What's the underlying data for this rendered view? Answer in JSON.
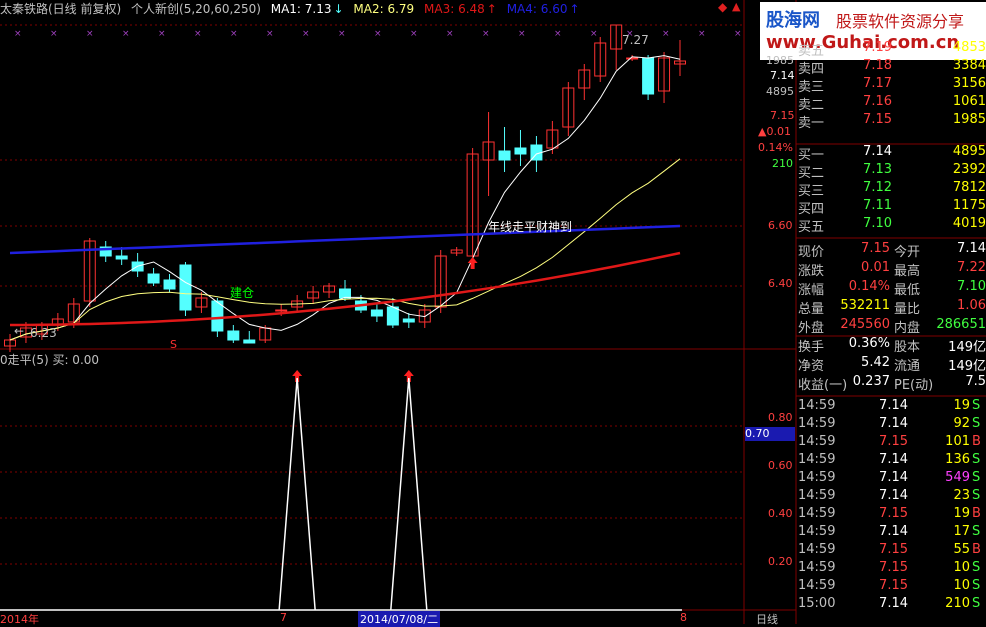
{
  "header": {
    "title": "太秦铁路(日线 前复权)",
    "indicator": "个人新创(5,20,60,250)",
    "ma1": "MA1: 7.13",
    "ma2": "MA2: 6.79",
    "ma3": "MA3: 6.48",
    "ma4": "MA4: 6.60",
    "ma1_arrow": "↓",
    "ma3_arrow": "↑",
    "ma4_arrow": "↑"
  },
  "logo": {
    "name": "股海网",
    "slogan": "股票软件资源分享",
    "url": "www.Guhai.com.cn"
  },
  "chart_annotations": {
    "high_label": "7.27",
    "low_label": "6.23",
    "signal_text": "年线走平财神到",
    "build_text": "建仓",
    "s_marker": "S"
  },
  "indicator_header": "0走平(5)  买: 0.00",
  "indicator_current": "0.70",
  "date_labels": [
    "2014年",
    "7",
    "2014/07/08/二",
    "8"
  ],
  "period_label": "日线",
  "side_prices": [
    "1985",
    "7.14",
    "4895",
    "7.15",
    "▲0.01",
    "0.14%",
    "210",
    "6.60",
    "6.40"
  ],
  "order_book": {
    "asks": [
      {
        "label": "卖五",
        "price": "7.19",
        "vol": "4853"
      },
      {
        "label": "卖四",
        "price": "7.18",
        "vol": "3384"
      },
      {
        "label": "卖三",
        "price": "7.17",
        "vol": "3156"
      },
      {
        "label": "卖二",
        "price": "7.16",
        "vol": "1061"
      },
      {
        "label": "卖一",
        "price": "7.15",
        "vol": "1985"
      }
    ],
    "bids": [
      {
        "label": "买一",
        "price": "7.14",
        "vol": "4895"
      },
      {
        "label": "买二",
        "price": "7.13",
        "vol": "2392"
      },
      {
        "label": "买三",
        "price": "7.12",
        "vol": "7812"
      },
      {
        "label": "买四",
        "price": "7.11",
        "vol": "1175"
      },
      {
        "label": "买五",
        "price": "7.10",
        "vol": "4019"
      }
    ]
  },
  "quote": [
    {
      "l1": "现价",
      "v1": "7.15",
      "l2": "今开",
      "v2": "7.14"
    },
    {
      "l1": "涨跌",
      "v1": "0.01",
      "l2": "最高",
      "v2": "7.22"
    },
    {
      "l1": "涨幅",
      "v1": "0.14%",
      "l2": "最低",
      "v2": "7.10"
    },
    {
      "l1": "总量",
      "v1": "532211",
      "l2": "量比",
      "v2": "1.06"
    },
    {
      "l1": "外盘",
      "v1": "245560",
      "l2": "内盘",
      "v2": "286651"
    },
    {
      "l1": "换手",
      "v1": "0.36%",
      "l2": "股本",
      "v2": "149亿"
    },
    {
      "l1": "净资",
      "v1": "5.42",
      "l2": "流通",
      "v2": "149亿"
    },
    {
      "l1": "收益(一)",
      "v1": "0.237",
      "l2": "PE(动)",
      "v2": "7.5"
    }
  ],
  "ticks": [
    {
      "time": "14:59",
      "price": "7.14",
      "vol": "19",
      "side": "S"
    },
    {
      "time": "14:59",
      "price": "7.14",
      "vol": "92",
      "side": "S"
    },
    {
      "time": "14:59",
      "price": "7.15",
      "vol": "101",
      "side": "B"
    },
    {
      "time": "14:59",
      "price": "7.14",
      "vol": "136",
      "side": "S"
    },
    {
      "time": "14:59",
      "price": "7.14",
      "vol": "549",
      "side": "S"
    },
    {
      "time": "14:59",
      "price": "7.14",
      "vol": "23",
      "side": "S"
    },
    {
      "time": "14:59",
      "price": "7.15",
      "vol": "19",
      "side": "B"
    },
    {
      "time": "14:59",
      "price": "7.14",
      "vol": "17",
      "side": "S"
    },
    {
      "time": "14:59",
      "price": "7.15",
      "vol": "55",
      "side": "B"
    },
    {
      "time": "14:59",
      "price": "7.15",
      "vol": "10",
      "side": "S"
    },
    {
      "time": "14:59",
      "price": "7.15",
      "vol": "10",
      "side": "S"
    },
    {
      "time": "15:00",
      "price": "7.14",
      "vol": "210",
      "side": "S"
    }
  ],
  "colors": {
    "up": "#ff3232",
    "down": "#54ffff",
    "ma1": "#ffffff",
    "ma2": "#ffff80",
    "ma3": "#e01818",
    "ma4": "#2020e0",
    "grid": "#800000",
    "panel_up": "#ff4040",
    "panel_down": "#40ff40",
    "text": "#c0c0c0",
    "yellow": "#ffff00"
  },
  "chart_data": {
    "type": "candlestick",
    "candles": [
      {
        "o": 6.2,
        "h": 6.24,
        "l": 6.18,
        "c": 6.22
      },
      {
        "o": 6.23,
        "h": 6.28,
        "l": 6.21,
        "c": 6.26
      },
      {
        "o": 6.24,
        "h": 6.28,
        "l": 6.22,
        "c": 6.27
      },
      {
        "o": 6.27,
        "h": 6.31,
        "l": 6.25,
        "c": 6.29
      },
      {
        "o": 6.28,
        "h": 6.36,
        "l": 6.26,
        "c": 6.34
      },
      {
        "o": 6.35,
        "h": 6.56,
        "l": 6.33,
        "c": 6.55
      },
      {
        "o": 6.53,
        "h": 6.55,
        "l": 6.48,
        "c": 6.5
      },
      {
        "o": 6.5,
        "h": 6.53,
        "l": 6.47,
        "c": 6.49
      },
      {
        "o": 6.48,
        "h": 6.51,
        "l": 6.43,
        "c": 6.45
      },
      {
        "o": 6.44,
        "h": 6.46,
        "l": 6.4,
        "c": 6.41
      },
      {
        "o": 6.42,
        "h": 6.44,
        "l": 6.38,
        "c": 6.39
      },
      {
        "o": 6.47,
        "h": 6.48,
        "l": 6.3,
        "c": 6.32
      },
      {
        "o": 6.33,
        "h": 6.38,
        "l": 6.31,
        "c": 6.36
      },
      {
        "o": 6.35,
        "h": 6.36,
        "l": 6.23,
        "c": 6.25
      },
      {
        "o": 6.25,
        "h": 6.27,
        "l": 6.21,
        "c": 6.22
      },
      {
        "o": 6.22,
        "h": 6.25,
        "l": 6.21,
        "c": 6.21
      },
      {
        "o": 6.22,
        "h": 6.27,
        "l": 6.21,
        "c": 6.26
      },
      {
        "o": 6.32,
        "h": 6.34,
        "l": 6.3,
        "c": 6.32
      },
      {
        "o": 6.33,
        "h": 6.37,
        "l": 6.31,
        "c": 6.35
      },
      {
        "o": 6.36,
        "h": 6.4,
        "l": 6.34,
        "c": 6.38
      },
      {
        "o": 6.38,
        "h": 6.41,
        "l": 6.36,
        "c": 6.4
      },
      {
        "o": 6.39,
        "h": 6.42,
        "l": 6.35,
        "c": 6.36
      },
      {
        "o": 6.35,
        "h": 6.37,
        "l": 6.31,
        "c": 6.32
      },
      {
        "o": 6.32,
        "h": 6.34,
        "l": 6.28,
        "c": 6.3
      },
      {
        "o": 6.33,
        "h": 6.36,
        "l": 6.26,
        "c": 6.27
      },
      {
        "o": 6.29,
        "h": 6.31,
        "l": 6.26,
        "c": 6.28
      },
      {
        "o": 6.28,
        "h": 6.34,
        "l": 6.26,
        "c": 6.32
      },
      {
        "o": 6.33,
        "h": 6.52,
        "l": 6.31,
        "c": 6.5
      },
      {
        "o": 6.51,
        "h": 6.53,
        "l": 6.5,
        "c": 6.52
      },
      {
        "o": 6.5,
        "h": 6.86,
        "l": 6.47,
        "c": 6.84
      },
      {
        "o": 6.82,
        "h": 6.98,
        "l": 6.7,
        "c": 6.88
      },
      {
        "o": 6.85,
        "h": 6.93,
        "l": 6.78,
        "c": 6.82
      },
      {
        "o": 6.86,
        "h": 6.92,
        "l": 6.8,
        "c": 6.84
      },
      {
        "o": 6.87,
        "h": 6.9,
        "l": 6.78,
        "c": 6.82
      },
      {
        "o": 6.86,
        "h": 6.95,
        "l": 6.84,
        "c": 6.92
      },
      {
        "o": 6.93,
        "h": 7.08,
        "l": 6.9,
        "c": 7.06
      },
      {
        "o": 7.06,
        "h": 7.14,
        "l": 7.02,
        "c": 7.12
      },
      {
        "o": 7.1,
        "h": 7.23,
        "l": 7.08,
        "c": 7.21
      },
      {
        "o": 7.19,
        "h": 7.27,
        "l": 7.12,
        "c": 7.27
      },
      {
        "o": 7.16,
        "h": 7.17,
        "l": 7.15,
        "c": 7.16
      },
      {
        "o": 7.16,
        "h": 7.17,
        "l": 7.02,
        "c": 7.04
      },
      {
        "o": 7.05,
        "h": 7.18,
        "l": 7.01,
        "c": 7.16
      },
      {
        "o": 7.14,
        "h": 7.22,
        "l": 7.1,
        "c": 7.15
      }
    ],
    "signal": [
      0,
      0,
      0,
      0,
      0,
      0,
      0,
      0,
      0,
      0,
      0,
      0,
      0,
      0,
      0,
      0,
      0,
      0,
      1,
      0,
      0,
      0,
      0,
      0,
      0,
      1,
      0,
      0,
      0,
      0,
      0,
      0,
      0,
      0,
      0,
      0,
      0,
      0,
      0,
      0,
      0,
      0,
      0
    ],
    "ylim": [
      6.2,
      7.3
    ],
    "indicator_ylim": [
      0,
      1
    ]
  }
}
